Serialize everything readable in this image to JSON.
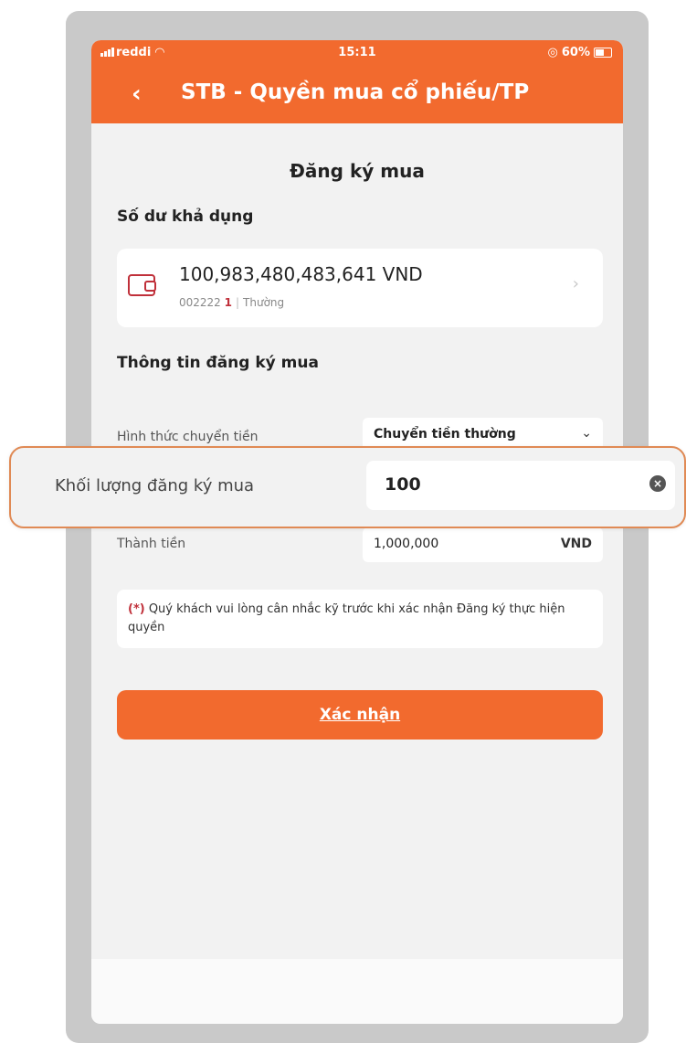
{
  "status_bar": {
    "carrier": "reddi",
    "time": "15:11",
    "battery": "60%"
  },
  "header": {
    "title": "STB - Quyền mua cổ phiếu/TP"
  },
  "main": {
    "heading": "Đăng ký mua",
    "balance_section_label": "Số dư khả dụng",
    "balance": {
      "amount": "100,983,480,483,641 VND",
      "account_number": "002222",
      "account_suffix": "1",
      "account_type": "Thường"
    },
    "info_section_label": "Thông tin đăng ký mua",
    "transfer_method": {
      "label": "Hình thức chuyển tiền",
      "value": "Chuyển tiền thường"
    },
    "quantity": {
      "label": "Khối lượng đăng ký mua",
      "value": "100"
    },
    "total": {
      "label": "Thành tiền",
      "value": "1,000,000",
      "unit": "VND"
    },
    "note": {
      "marker": "(*)",
      "text": "Quý khách vui lòng cân nhắc kỹ trước khi xác nhận Đăng ký thực hiện quyền"
    },
    "confirm_label": "Xác nhận"
  },
  "icons": {
    "back": "chevron-left-icon",
    "wallet": "wallet-icon",
    "chevron_right": "chevron-right-icon",
    "dropdown": "chevron-down-icon",
    "clear": "clear-icon"
  },
  "colors": {
    "brand": "#f26a2e",
    "accent_red": "#c0303a",
    "background": "#f2f2f2"
  }
}
